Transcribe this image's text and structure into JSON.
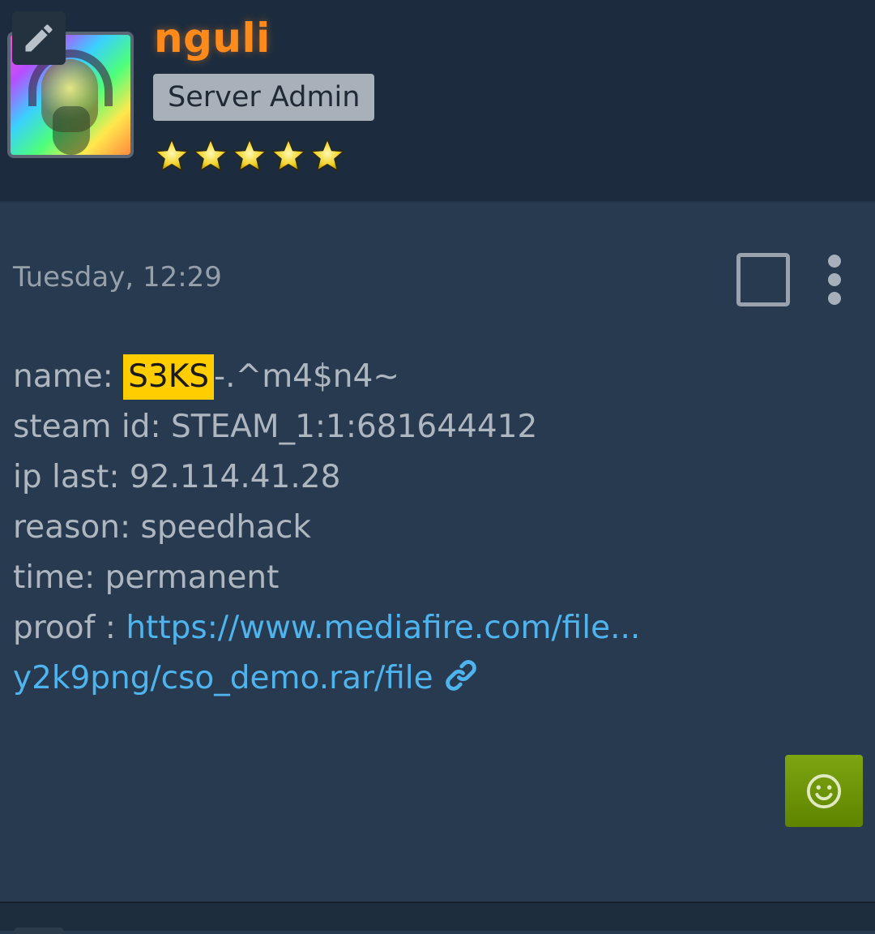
{
  "profile": {
    "username": "nguli",
    "role": "Server Admin",
    "rating_stars": 5,
    "username_color": "#ff8a1c"
  },
  "icons": {
    "edit": "pencil-icon",
    "select": "checkbox-icon",
    "menu": "more-vertical-icon",
    "link": "link-icon",
    "react": "smiley-icon"
  },
  "post": {
    "timestamp": "Tuesday, 12:29",
    "lines": [
      {
        "label": "name: ",
        "highlight": "S3KS",
        "rest": "-.^m4$n4~"
      },
      {
        "label": "steam id: ",
        "value": "STEAM_1:1:681644412"
      },
      {
        "label": "ip last: ",
        "value": "92.114.41.28"
      },
      {
        "label": "reason: ",
        "value": "speedhack"
      },
      {
        "label": "time: ",
        "value": "permanent"
      },
      {
        "label": "proof : ",
        "link_line1": "https://www.mediafire.com/file...",
        "link_line2": "y2k9png/cso_demo.rar/file"
      }
    ]
  },
  "colors": {
    "highlight": "#ffcd00",
    "link": "#4fb4ee",
    "react_button": "#6f9608"
  }
}
